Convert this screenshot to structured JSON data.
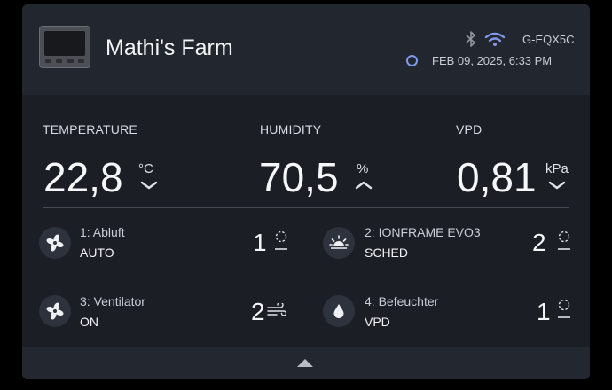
{
  "header": {
    "title": "Mathi's Farm",
    "device_id": "G-EQX5C",
    "timestamp": "FEB 09, 2025, 6:33 PM",
    "icons": [
      "controller-device-icon",
      "bluetooth-icon",
      "wifi-icon",
      "clock-icon"
    ]
  },
  "metrics": [
    {
      "label": "TEMPERATURE",
      "value": "22,8",
      "unit": "°C",
      "trend": "down"
    },
    {
      "label": "HUMIDITY",
      "value": "70,5",
      "unit": "%",
      "trend": "up"
    },
    {
      "label": "VPD",
      "value": "0,81",
      "unit": "kPa",
      "trend": "down"
    }
  ],
  "devices": [
    {
      "name": "1: Abluft",
      "mode": "AUTO",
      "level": "1",
      "icon": "fan-icon"
    },
    {
      "name": "2: IONFRAME EVO3",
      "mode": "SCHED",
      "level": "2",
      "icon": "sunrise-icon"
    },
    {
      "name": "3: Ventilator",
      "mode": "ON",
      "level": "2",
      "icon": "fan-icon"
    },
    {
      "name": "4: Befeuchter",
      "mode": "VPD",
      "level": "1",
      "icon": "water-drop-icon"
    }
  ],
  "colors": {
    "background": "#000000",
    "card": "#1b1e24",
    "header": "#22262e",
    "accent": "#7e98ea",
    "icon_circle": "#2d323c"
  }
}
